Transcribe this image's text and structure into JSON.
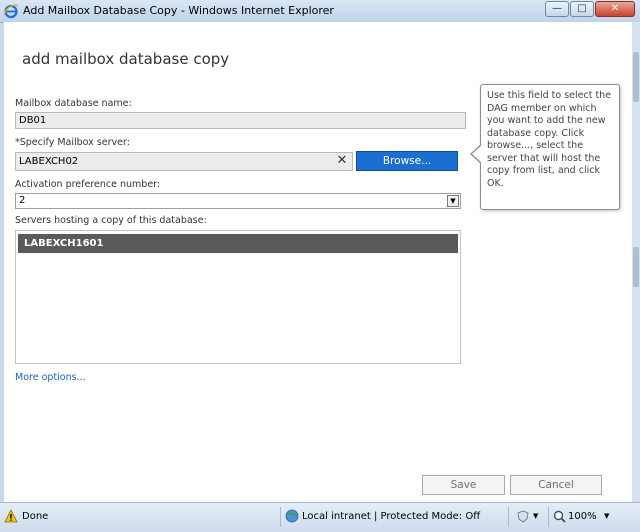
{
  "window": {
    "title": "Add Mailbox Database Copy - Windows Internet Explorer",
    "minimize_glyph": "—",
    "maximize_glyph": "□",
    "close_glyph": "✕"
  },
  "dialog": {
    "heading": "add mailbox database copy",
    "db_name_label": "Mailbox database name:",
    "db_name_value": "DB01",
    "server_label": "*Specify Mailbox server:",
    "server_value": "LABEXCH02",
    "clear_glyph": "✕",
    "browse_label": "Browse...",
    "activation_label": "Activation preference number:",
    "activation_value": "2",
    "servers_label": "Servers hosting a copy of this database:",
    "servers_list": [
      "LABEXCH1601"
    ],
    "more_options": "More options...",
    "save_label": "Save",
    "cancel_label": "Cancel"
  },
  "tooltip": {
    "text": "Use this field to select the DAG member on which you want to add the new database copy. Click browse..., select the server that will host the copy from list, and click OK."
  },
  "statusbar": {
    "status": "Done",
    "zone": "Local intranet | Protected Mode: Off",
    "zoom": "100%",
    "dropdown_glyph": "▼"
  },
  "icons": {
    "browser": "ie-logo-icon",
    "warning": "warning-icon",
    "zone": "globe-icon",
    "zoom": "magnifier-icon",
    "protect": "shield-icon"
  },
  "colors": {
    "accent": "#1a6fd0",
    "selected_row": "#5a5a5a",
    "link": "#1566b8",
    "field_bg": "#ececec"
  }
}
